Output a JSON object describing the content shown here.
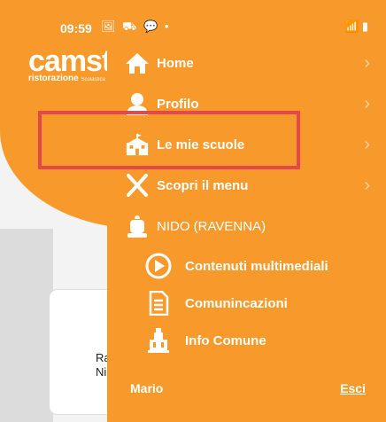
{
  "status_bar": {
    "time": "09:59",
    "left_icons": "🖼 ⛟ 💬 •",
    "right_icons": "📶 ▮"
  },
  "background": {
    "logo": "camst",
    "logo_sub": "ristorazione",
    "logo_sub_small": "Scolastica",
    "card_text_line1": "Ra",
    "card_text_line2": "Ni"
  },
  "drawer": {
    "items": [
      {
        "label": "Home",
        "icon": "home-icon"
      },
      {
        "label": "Profilo",
        "icon": "person-icon"
      },
      {
        "label": "Le mie scuole",
        "icon": "school-icon"
      },
      {
        "label": "Scopri il menu",
        "icon": "cutlery-icon"
      }
    ],
    "school": {
      "label": "NIDO (RAVENNA)",
      "icon": "school-bag-icon"
    },
    "sub_items": [
      {
        "label": "Contenuti multimediali",
        "icon": "play-icon"
      },
      {
        "label": "Comunincazioni",
        "icon": "document-icon"
      },
      {
        "label": "Info Comune",
        "icon": "town-hall-icon"
      }
    ],
    "user_name": "Mario",
    "exit_label": "Esci",
    "chevron": "›"
  },
  "colors": {
    "primary": "#f79a2b",
    "highlight": "#e4474d",
    "text": "#ffffff"
  }
}
